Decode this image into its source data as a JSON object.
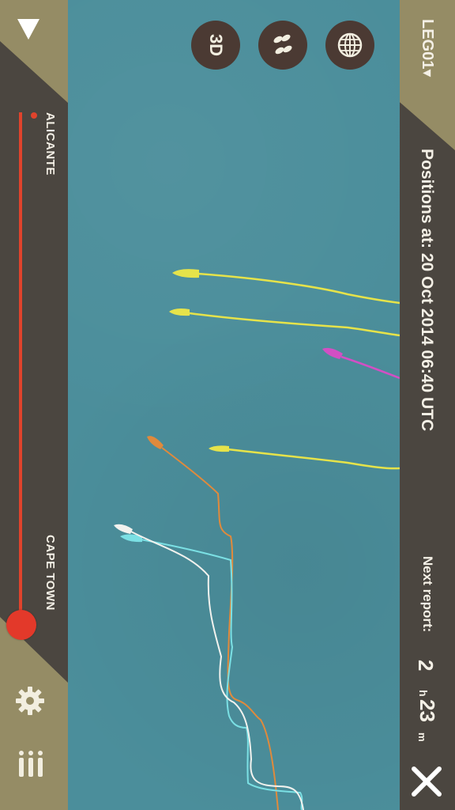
{
  "header": {
    "leg_label": "LEG01▾",
    "positions_label": "Positions at: 20 Oct 2014 06:40 UTC"
  },
  "view_controls": {
    "three_d_label": "3D",
    "footprints_icon": "footprints-icon",
    "globe_icon": "globe-icon"
  },
  "timeline": {
    "start_port": "ALICANTE",
    "end_port": "CAPE TOWN",
    "progress": 1.0
  },
  "next_report": {
    "label": "Next report:",
    "hours": "2",
    "hours_unit": "h",
    "minutes": "23",
    "minutes_unit": "m"
  },
  "sidebar_icons": {
    "collapse": "triangle-down-icon",
    "settings": "gear-icon",
    "leaderboard": "leaderboard-icon",
    "close": "close-icon"
  },
  "colors": {
    "ocean": "#4b8e9b",
    "panel": "#4b4640",
    "panel_accent": "#958c65",
    "timeline": "#e0432c",
    "boat_yellow": "#e6e34a",
    "boat_magenta": "#d24fc4",
    "boat_orange": "#e08a3c",
    "boat_cyan": "#7be0e4",
    "boat_white": "#f2f2ee"
  }
}
